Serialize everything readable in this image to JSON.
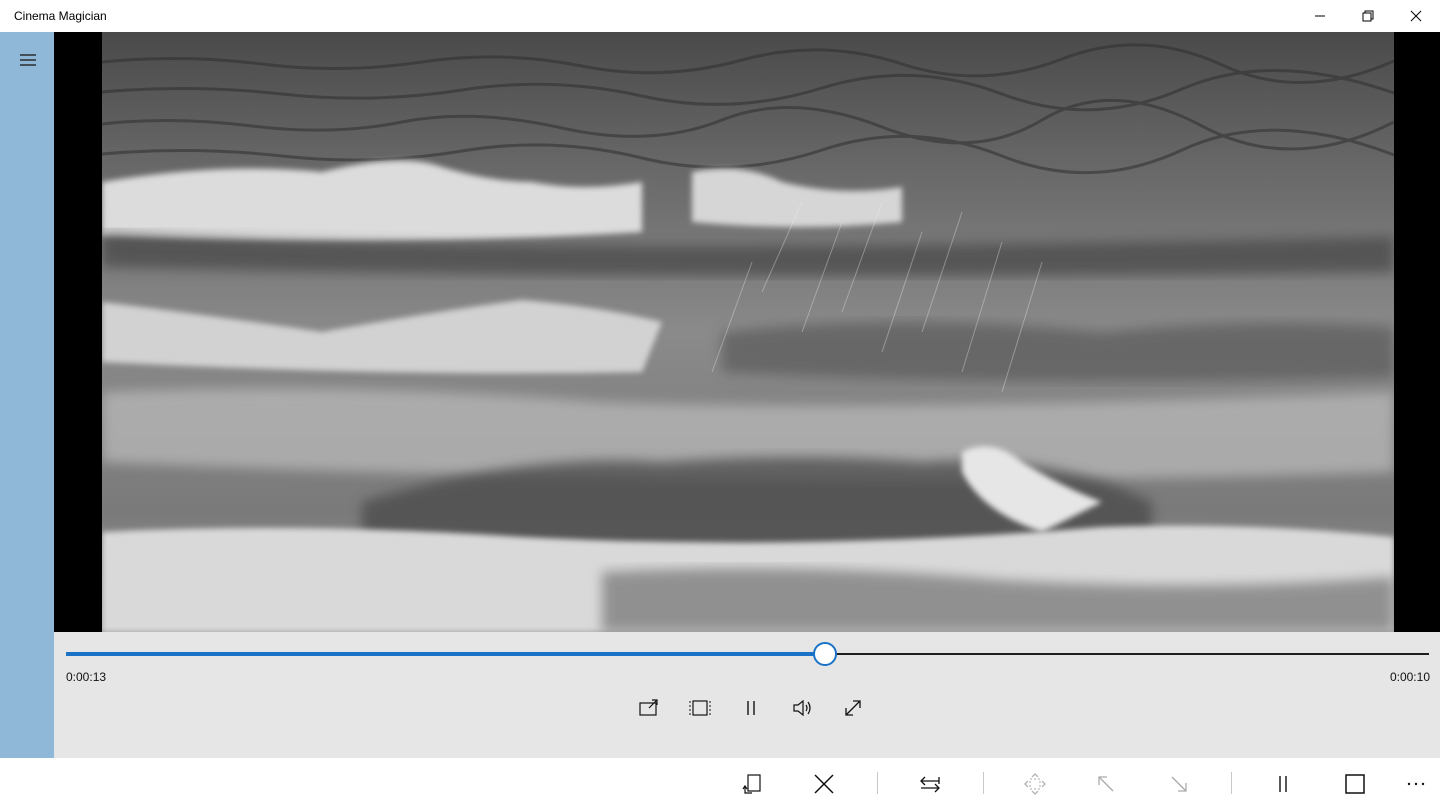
{
  "app": {
    "title": "Cinema Magician"
  },
  "window_controls": [
    "minimize-icon",
    "restore-icon",
    "close-icon"
  ],
  "nav": {
    "menu_icon": "hamburger-icon"
  },
  "video": {
    "description_icon": "video-frame"
  },
  "player": {
    "progress": 0.557,
    "time_elapsed": "0:00:13",
    "time_remaining": "0:00:10",
    "controls": [
      "cast-icon",
      "aspect-ratio-icon",
      "pause-icon",
      "volume-icon",
      "fullscreen-icon"
    ],
    "accent": "#1a73c7"
  },
  "appbar": {
    "items": [
      "rotate-icon",
      "close-icon",
      "swap-icon",
      "move-icon",
      "arrow-up-left-icon",
      "arrow-down-right-icon",
      "pause-icon",
      "stop-icon",
      "more-icon"
    ]
  },
  "colors": {
    "nav_pane": "#8fb7d7",
    "transport_bg": "#e6e6e6"
  }
}
